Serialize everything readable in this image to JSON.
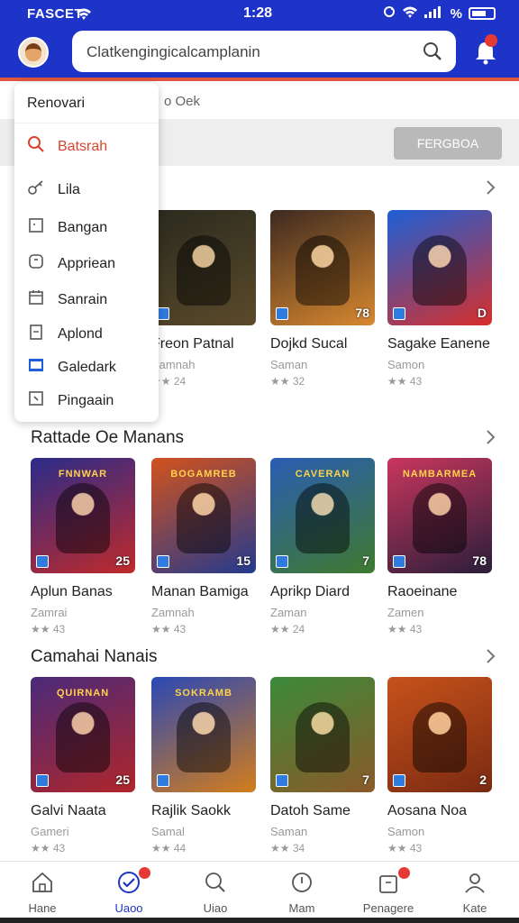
{
  "status": {
    "carrier": "FASCET",
    "time": "1:28",
    "battery_text": "%"
  },
  "search": {
    "placeholder": "Clatkengingicalcamplanin"
  },
  "band": {
    "hint": "o Oek",
    "button": "FERGBOA"
  },
  "menu": {
    "title": "Renovari",
    "items": [
      {
        "label": "Batsrah",
        "icon": "search-icon",
        "active": true
      },
      {
        "label": "Lila",
        "icon": "key-icon"
      },
      {
        "label": "Bangan",
        "icon": "square-icon"
      },
      {
        "label": "Appriean",
        "icon": "rounded-square-icon"
      },
      {
        "label": "Sanrain",
        "icon": "calendar-icon"
      },
      {
        "label": "Aplond",
        "icon": "document-icon"
      },
      {
        "label": "Galedark",
        "icon": "blue-folder-icon"
      },
      {
        "label": "Pingaain",
        "icon": "tag-icon"
      }
    ]
  },
  "sections": [
    {
      "title": "",
      "cards": [
        {
          "name": "Freon Patnal",
          "sub": "Samnah",
          "rating": "★★ 24",
          "badge": "",
          "colors": [
            "#2a2a1e",
            "#5b4a2a"
          ]
        },
        {
          "name": "Dojkd Sucal",
          "sub": "Saman",
          "rating": "★★ 32",
          "badge": "78",
          "colors": [
            "#3d2a20",
            "#d8882f"
          ]
        },
        {
          "name": "Sagake Eanene",
          "sub": "Samon",
          "rating": "★★ 43",
          "badge": "D",
          "colors": [
            "#1d5fd6",
            "#d72f2a"
          ]
        }
      ]
    },
    {
      "title": "Rattade Oe Manans",
      "cards": [
        {
          "name": "Aplun Banas",
          "sub": "Zamrai",
          "rating": "★★ 43",
          "badge": "25",
          "logo": "FNNWAR",
          "colors": [
            "#2b2b8a",
            "#c02a2a"
          ]
        },
        {
          "name": "Manan Bamiga",
          "sub": "Zamnah",
          "rating": "★★ 43",
          "badge": "15",
          "logo": "BOGAMREB",
          "colors": [
            "#d2521d",
            "#243a8e"
          ]
        },
        {
          "name": "Aprikp Diard",
          "sub": "Zaman",
          "rating": "★★ 24",
          "badge": "7",
          "logo": "CAVERAN",
          "colors": [
            "#2a5db3",
            "#3f7a2e"
          ]
        },
        {
          "name": "Raoeinane",
          "sub": "Zamen",
          "rating": "★★ 43",
          "badge": "78",
          "logo": "NAMBARMEA",
          "colors": [
            "#c9365e",
            "#2a1e3a"
          ]
        }
      ]
    },
    {
      "title": "Camahai Nanais",
      "cards": [
        {
          "name": "Galvi Naata",
          "sub": "Gameri",
          "rating": "★★ 43",
          "badge": "25",
          "logo": "QUIRNAN",
          "colors": [
            "#4a2a7a",
            "#b0262a"
          ]
        },
        {
          "name": "Rajlik Saokk",
          "sub": "Samal",
          "rating": "★★ 44",
          "badge": "",
          "logo": "SOKRAMB",
          "colors": [
            "#2a48b5",
            "#d37d1c"
          ]
        },
        {
          "name": "Datoh Same",
          "sub": "Saman",
          "rating": "★★ 34",
          "badge": "7",
          "logo": "",
          "colors": [
            "#3b8a3a",
            "#8a5a2a"
          ]
        },
        {
          "name": "Aosana Noa",
          "sub": "Samon",
          "rating": "★★ 43",
          "badge": "2",
          "logo": "",
          "colors": [
            "#c7521a",
            "#7a2a12"
          ]
        }
      ]
    }
  ],
  "nav": [
    {
      "label": "Hane",
      "icon": "home-icon"
    },
    {
      "label": "Uaoo",
      "icon": "check-circle-icon",
      "active": true,
      "dot": true
    },
    {
      "label": "Uiao",
      "icon": "search-icon"
    },
    {
      "label": "Mam",
      "icon": "clock-icon"
    },
    {
      "label": "Penagere",
      "icon": "bag-icon",
      "dot": true
    },
    {
      "label": "Kate",
      "icon": "user-icon"
    }
  ]
}
